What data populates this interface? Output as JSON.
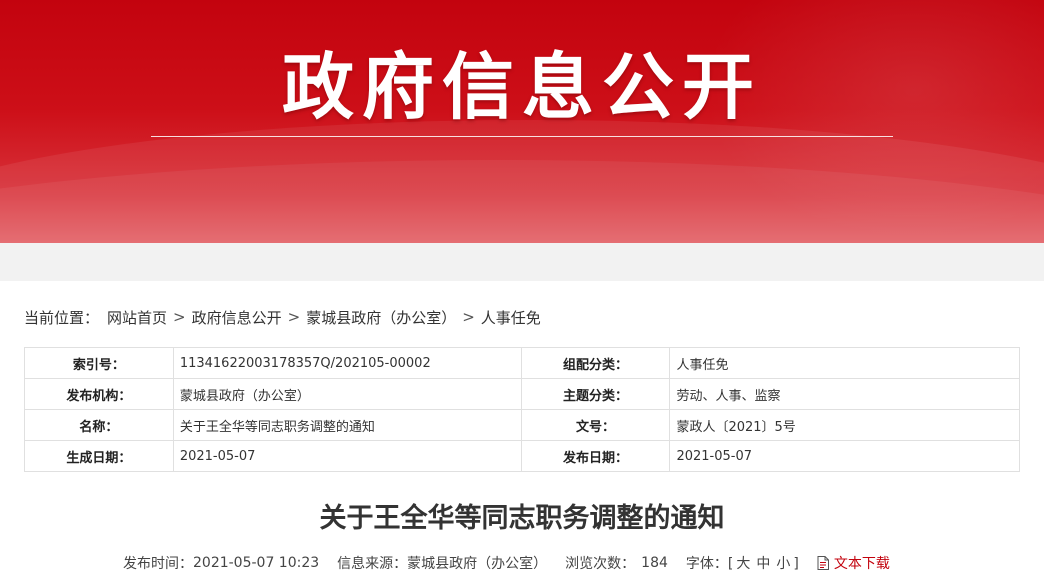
{
  "banner": {
    "title": "政府信息公开"
  },
  "breadcrumb": {
    "label": "当前位置：",
    "items": [
      "网站首页",
      "政府信息公开",
      "蒙城县政府（办公室）",
      "人事任免"
    ],
    "separator": ">"
  },
  "meta": {
    "rows": [
      {
        "k1": "索引号：",
        "v1": "11341622003178357Q/202105-00002",
        "k2": "组配分类：",
        "v2": "人事任免"
      },
      {
        "k1": "发布机构：",
        "v1": "蒙城县政府（办公室）",
        "k2": "主题分类：",
        "v2": "劳动、人事、监察"
      },
      {
        "k1": "名称：",
        "v1": "关于王全华等同志职务调整的通知",
        "k2": "文号：",
        "v2": "蒙政人〔2021〕5号"
      },
      {
        "k1": "生成日期：",
        "v1": "2021-05-07",
        "k2": "发布日期：",
        "v2": "2021-05-07"
      }
    ]
  },
  "article": {
    "title": "关于王全华等同志职务调整的通知"
  },
  "info": {
    "publish_time_label": "发布时间：",
    "publish_time": "2021-05-07 10:23",
    "source_label": "信息来源：",
    "source": "蒙城县政府（办公室）",
    "views_label": "浏览次数：",
    "views": "184",
    "font_label": "字体：[",
    "font_large": "大",
    "font_medium": "中",
    "font_small": "小",
    "font_close": "]",
    "download_label": "文本下载",
    "download_icon": "document-icon"
  },
  "colors": {
    "brand_red": "#c3030e",
    "grey_band": "#f2f2f2",
    "table_border": "#e0e0e0"
  }
}
